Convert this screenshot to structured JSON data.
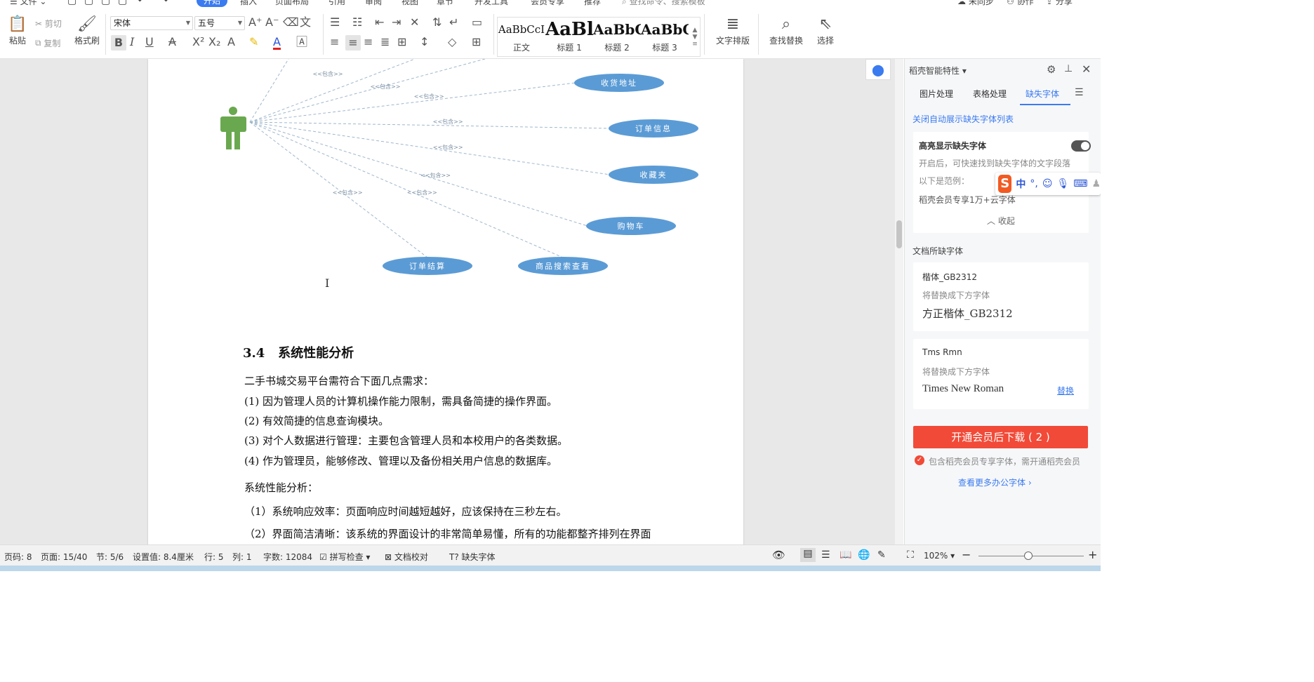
{
  "menu": {
    "file": "文件",
    "tabs": [
      "开始",
      "插入",
      "页面布局",
      "引用",
      "审阅",
      "视图",
      "章节",
      "开发工具",
      "会员专享",
      "推荐"
    ],
    "search": "查找命令、搜索模板",
    "sync": "未同步",
    "collab": "协作",
    "share": "分享"
  },
  "ribbon": {
    "paste": "粘贴",
    "cut": "剪切",
    "copy": "复制",
    "format_painter": "格式刷",
    "font_name": "宋体",
    "font_size": "五号",
    "styles": [
      {
        "sample": "AaBbCcI",
        "label": "正文"
      },
      {
        "sample": "AaBl",
        "label": "标题 1"
      },
      {
        "sample": "AaBbC",
        "label": "标题 2"
      },
      {
        "sample": "AaBbC",
        "label": "标题 3"
      }
    ],
    "text_layout": "文字排版",
    "find_replace": "查找替换",
    "select": "选择"
  },
  "diagram": {
    "include_label": "<<包含>>",
    "use_cases": [
      "收货地址",
      "订单信息",
      "收藏夹",
      "购物车",
      "订单结算",
      "商品搜索查看"
    ]
  },
  "document": {
    "heading_num": "3.4",
    "heading_text": "系统性能分析",
    "paragraphs": [
      "二手书城交易平台需符合下面几点需求：",
      "(1) 因为管理人员的计算机操作能力限制，需具备简捷的操作界面。",
      "(2) 有效简捷的信息查询模块。",
      "(3) 对个人数据进行管理：主要包含管理人员和本校用户的各类数据。",
      "(4) 作为管理员，能够修改、管理以及备份相关用户信息的数据库。",
      "系统性能分析：",
      "（1）系统响应效率：页面响应时间越短越好，应该保持在三秒左右。",
      "（2）界面简洁清晰：该系统的界面设计的非常简单易懂，所有的功能都整齐排列在界面"
    ]
  },
  "panel": {
    "title": "稻壳智能特性",
    "tabs": [
      "图片处理",
      "表格处理",
      "缺失字体"
    ],
    "close_auto": "关闭自动展示缺失字体列表",
    "highlight_title": "高亮显示缺失字体",
    "highlight_desc": "开启后，可快速找到缺失字体的文字段落",
    "example_label": "以下是范例：",
    "promo": "稻壳会员专享1万+云字体",
    "collapse": "收起",
    "missing_title": "文档所缺字体",
    "fonts": [
      {
        "name": "楷体_GB2312",
        "replace_label": "将替换成下方字体",
        "replacement": "方正楷体_GB2312",
        "action": ""
      },
      {
        "name": "Tms Rmn",
        "replace_label": "将替换成下方字体",
        "replacement": "Times New Roman",
        "action": "替换"
      }
    ],
    "download_btn": "开通会员后下载 ( 2 )",
    "member_note": "包含稻壳会员专享字体，需开通稻壳会员",
    "more_fonts": "查看更多办公字体 ›"
  },
  "status": {
    "page_code": "页码: 8",
    "page": "页面: 15/40",
    "section": "节: 5/6",
    "setting": "设置值: 8.4厘米",
    "row": "行: 5",
    "col": "列: 1",
    "words": "字数: 12084",
    "spell": "拼写检查",
    "proof": "文档校对",
    "missing_font": "缺失字体",
    "zoom": "102%"
  },
  "colors": {
    "accent": "#3a7bf0",
    "actor": "#6aa84f",
    "usecase": "#5b9bd5",
    "download": "#f24a38"
  }
}
